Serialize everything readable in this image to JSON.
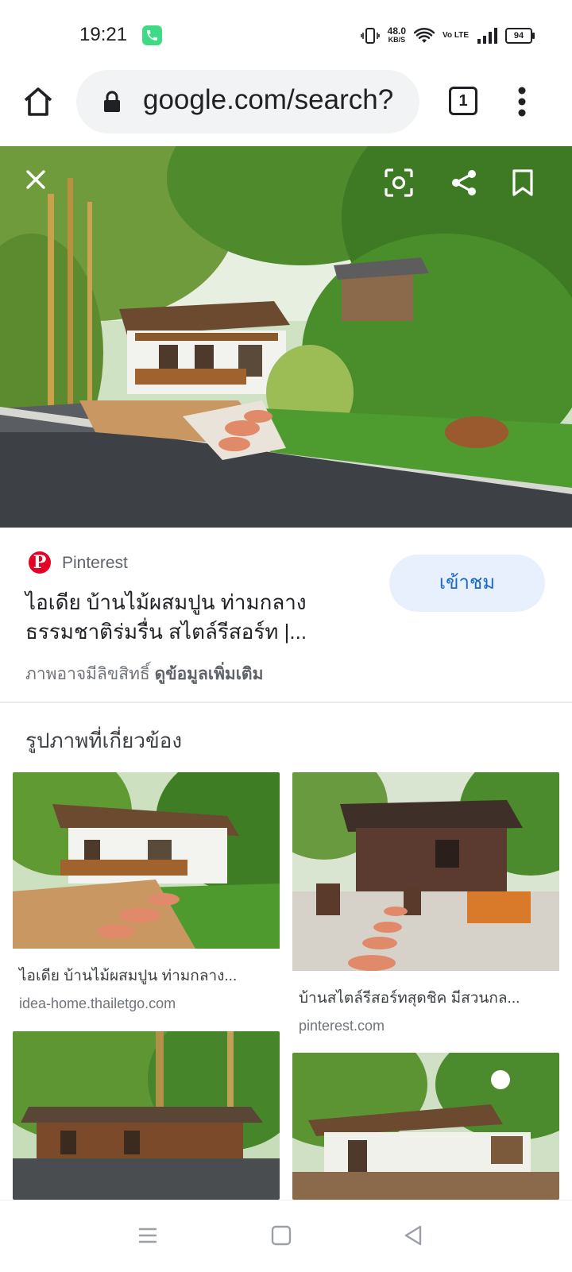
{
  "status_bar": {
    "time": "19:21",
    "net_speed": "48.0",
    "net_speed_unit": "KB/S",
    "volte": "Vo LTE",
    "battery": "94"
  },
  "browser": {
    "url": "google.com/search?",
    "tab_count": "1"
  },
  "result": {
    "source": "Pinterest",
    "title": "ไอเดีย บ้านไม้ผสมปูน ท่ามกลางธรรมชาติร่มรื่น สไตล์รีสอร์ท |...",
    "visit_label": "เข้าชม",
    "copyright_text": "ภาพอาจมีลิขสิทธิ์",
    "more_info_label": "ดูข้อมูลเพิ่มเติม"
  },
  "related": {
    "heading": "รูปภาพที่เกี่ยวข้อง",
    "items": [
      {
        "caption": "ไอเดีย บ้านไม้ผสมปูน ท่ามกลาง...",
        "domain": "idea-home.thailetgo.com"
      },
      {
        "caption": "บ้านสไตล์รีสอร์ทสุดชิค มีสวนกล...",
        "domain": "pinterest.com"
      },
      {
        "caption": "",
        "domain": ""
      },
      {
        "caption": "",
        "domain": ""
      }
    ]
  },
  "icons": {
    "close": "close-icon",
    "lens": "lens-icon",
    "share": "share-icon",
    "bookmark": "bookmark-icon"
  }
}
